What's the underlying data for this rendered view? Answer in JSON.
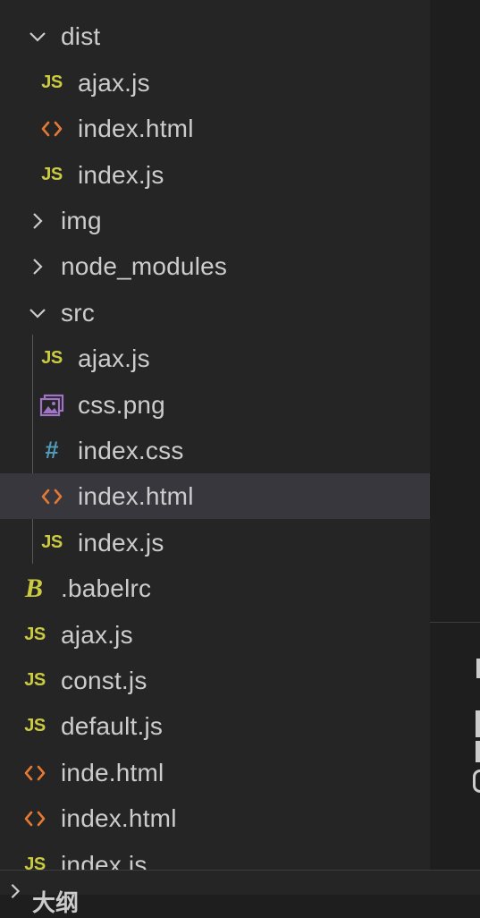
{
  "explorer": {
    "items": [
      {
        "label": "dist",
        "kind": "folder",
        "expanded": true,
        "icon": "chevron-down-icon"
      },
      {
        "label": "ajax.js",
        "kind": "js",
        "icon": "javascript-file-icon"
      },
      {
        "label": "index.html",
        "kind": "html",
        "icon": "html-file-icon"
      },
      {
        "label": "index.js",
        "kind": "js",
        "icon": "javascript-file-icon"
      },
      {
        "label": "img",
        "kind": "folder",
        "expanded": false,
        "icon": "chevron-right-icon"
      },
      {
        "label": "node_modules",
        "kind": "folder",
        "expanded": false,
        "icon": "chevron-right-icon"
      },
      {
        "label": "src",
        "kind": "folder",
        "expanded": true,
        "icon": "chevron-down-icon"
      },
      {
        "label": "ajax.js",
        "kind": "js",
        "icon": "javascript-file-icon"
      },
      {
        "label": "css.png",
        "kind": "image",
        "icon": "image-file-icon"
      },
      {
        "label": "index.css",
        "kind": "css",
        "icon": "css-file-icon"
      },
      {
        "label": "index.html",
        "kind": "html",
        "icon": "html-file-icon",
        "selected": true
      },
      {
        "label": "index.js",
        "kind": "js",
        "icon": "javascript-file-icon"
      },
      {
        "label": ".babelrc",
        "kind": "babel",
        "icon": "babel-file-icon"
      },
      {
        "label": "ajax.js",
        "kind": "js",
        "icon": "javascript-file-icon"
      },
      {
        "label": "const.js",
        "kind": "js",
        "icon": "javascript-file-icon"
      },
      {
        "label": "default.js",
        "kind": "js",
        "icon": "javascript-file-icon"
      },
      {
        "label": "inde.html",
        "kind": "html",
        "icon": "html-file-icon"
      },
      {
        "label": "index.html",
        "kind": "html",
        "icon": "html-file-icon"
      },
      {
        "label": "index.js",
        "kind": "js",
        "icon": "javascript-file-icon"
      }
    ],
    "js_badge": "JS",
    "css_badge": "#",
    "babel_badge": "B"
  },
  "outline": {
    "label": "大纲"
  },
  "colors": {
    "sidebar_bg": "#252526",
    "editor_bg": "#1e1e1e",
    "selected_bg": "#37373d",
    "text": "#cccccc",
    "js": "#cbcb41",
    "html": "#e37933",
    "css": "#519aba",
    "image": "#a074c4"
  }
}
